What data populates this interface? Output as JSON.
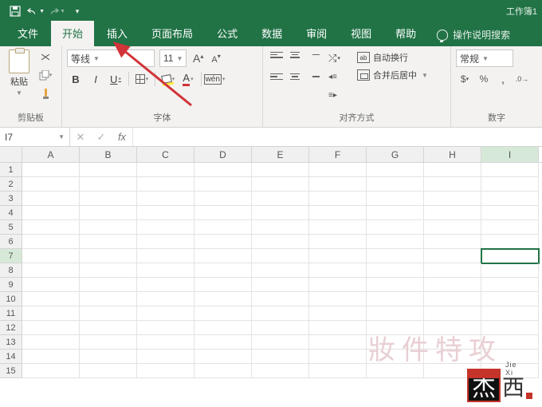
{
  "title": {
    "workbook": "工作簿1"
  },
  "tabs": {
    "file": "文件",
    "home": "开始",
    "insert": "插入",
    "layout": "页面布局",
    "formulas": "公式",
    "data": "数据",
    "review": "审阅",
    "view": "视图",
    "help": "帮助",
    "search": "操作说明搜索"
  },
  "ribbon": {
    "clipboard": {
      "paste": "粘贴",
      "label": "剪贴板"
    },
    "font": {
      "name": "等线",
      "size": "11",
      "label": "字体",
      "A_big": "A",
      "A_small": "A",
      "bold": "B",
      "italic": "I",
      "underline": "U",
      "A_color": "A",
      "wen": "wén"
    },
    "align": {
      "wrap": "自动换行",
      "merge": "合并后居中",
      "label": "对齐方式"
    },
    "number": {
      "format": "常规",
      "label": "数字"
    }
  },
  "namebox": {
    "ref": "I7",
    "fx": "fx"
  },
  "columns": [
    "A",
    "B",
    "C",
    "D",
    "E",
    "F",
    "G",
    "H",
    "I"
  ],
  "rows": [
    "1",
    "2",
    "3",
    "4",
    "5",
    "6",
    "7",
    "8",
    "9",
    "10",
    "11",
    "12",
    "13",
    "14",
    "15"
  ],
  "active": {
    "col": "I",
    "row": "7"
  },
  "watermark": "妝件特攻",
  "logo": {
    "jie": "杰",
    "xi": "西",
    "pin": "Jie Xi"
  }
}
